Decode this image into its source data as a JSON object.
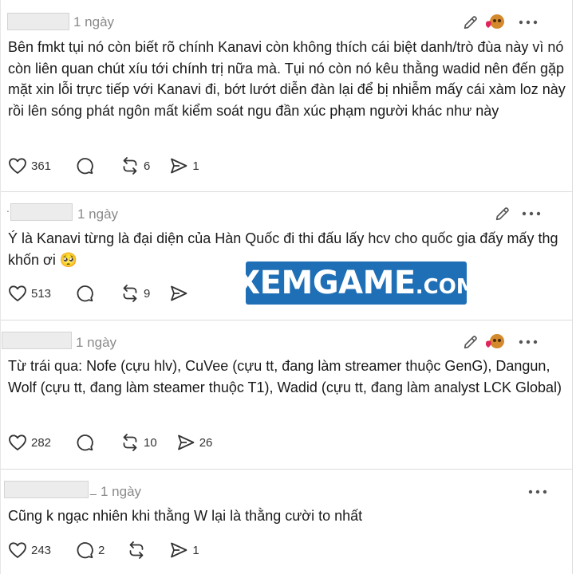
{
  "posts": [
    {
      "time": "1 ngày",
      "text": "Bên fmkt tụi nó còn biết rõ chính Kanavi còn không thích cái biệt danh/trò đùa này vì nó còn liên quan chút xíu tới chính trị nữa mà. Tụi nó còn nó kêu thằng wadid nên đến gặp mặt xin lỗi trực tiếp với Kanavi đi, bớt lướt diễn đàn lại để bị nhiễm mấy cái xàm loz này rồi lên sóng phát ngôn mất kiểm soát ngu đần xúc phạm người khác như này",
      "likes": "361",
      "replies": "",
      "reposts": "6",
      "shares": "1"
    },
    {
      "time": "1 ngày",
      "text": "Ý là Kanavi từng là đại diện của Hàn Quốc đi thi đấu lấy hcv cho quốc gia đấy mấy thg khốn ơi 🥺",
      "likes": "513",
      "replies": "",
      "reposts": "9",
      "shares": ""
    },
    {
      "time": "1 ngày",
      "text": "Từ trái qua: Nofe (cựu hlv), CuVee (cựu tt, đang làm streamer thuộc GenG), Dangun, Wolf (cựu tt, đang làm steamer thuộc T1), Wadid (cựu tt, đang làm analyst LCK Global)",
      "likes": "282",
      "replies": "",
      "reposts": "10",
      "shares": "26"
    },
    {
      "time": "1 ngày",
      "text": "Cũng k ngạc nhiên khi thằng W lại là thằng cười to nhất",
      "likes": "243",
      "replies": "2",
      "reposts": "",
      "shares": "1"
    }
  ],
  "watermark": {
    "main": "XEMGAME",
    "suffix": ".COM",
    "color": "#1f6fb6"
  },
  "icons": [
    "edit-icon",
    "avatar-badge-icon",
    "more-icon",
    "heart-icon",
    "reply-icon",
    "repost-icon",
    "share-icon"
  ]
}
